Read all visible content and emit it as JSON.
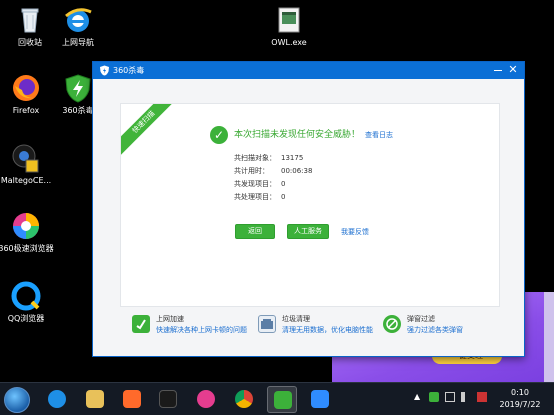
{
  "desktop": {
    "icons": [
      {
        "label": "回收站",
        "icon": "recycle-bin-icon"
      },
      {
        "label": "上网导航",
        "icon": "ie-browser-icon"
      },
      {
        "label": "OWL.exe",
        "icon": "exe-file-icon"
      },
      {
        "label": "Firefox",
        "icon": "firefox-icon"
      },
      {
        "label": "360杀毒",
        "icon": "360-shield-icon"
      },
      {
        "label": "MaltegoCE...",
        "icon": "maltego-icon"
      },
      {
        "label": "360极速浏览器",
        "icon": "360-browser-icon"
      },
      {
        "label": "QQ浏览器",
        "icon": "qq-browser-icon"
      }
    ]
  },
  "window": {
    "title": "360杀毒",
    "close": "✕",
    "ribbon": "快速扫描",
    "result_text": "本次扫描未发现任何安全威胁！",
    "view_log": "查看日志",
    "stats": [
      {
        "label": "共扫描对象：",
        "value": "13175"
      },
      {
        "label": "共计用时：",
        "value": "00:06:38"
      },
      {
        "label": "共发现项目：",
        "value": "0"
      },
      {
        "label": "共处理项目：",
        "value": "0"
      }
    ],
    "back_button": "返回",
    "manual_service_button": "人工服务",
    "feedback_link": "我要反馈",
    "features": [
      {
        "title": "上网加速",
        "desc": "快速解决各种上网卡顿的问题",
        "icon": "speed-up-icon"
      },
      {
        "title": "垃圾清理",
        "desc": "清理无用数据，优化电脑性能",
        "icon": "cleanup-icon"
      },
      {
        "title": "弹窗过滤",
        "desc": "强力过滤各类弹窗",
        "icon": "popup-filter-icon"
      }
    ]
  },
  "promo": {
    "button": "一键受理"
  },
  "taskbar": {
    "time": "0:10",
    "date": "2019/7/22"
  },
  "colors": {
    "accent": "#0b6fd6",
    "success": "#3cb13a",
    "link": "#1c6fd0"
  }
}
